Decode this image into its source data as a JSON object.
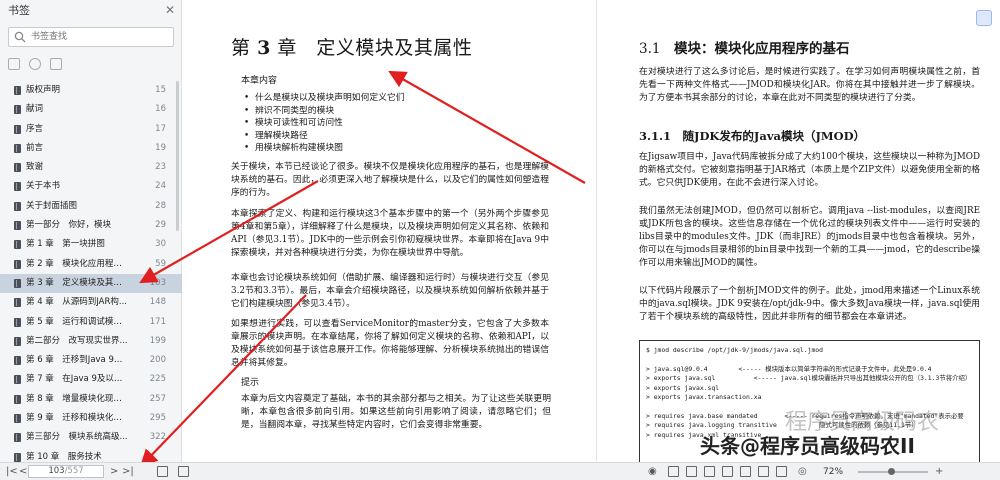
{
  "sidebar": {
    "title": "书签",
    "search_placeholder": "书签查找",
    "items": [
      {
        "label": "版权声明",
        "page": "15"
      },
      {
        "label": "献词",
        "page": "16"
      },
      {
        "label": "序言",
        "page": "17"
      },
      {
        "label": "前言",
        "page": "19"
      },
      {
        "label": "致谢",
        "page": "23"
      },
      {
        "label": "关于本书",
        "page": "24"
      },
      {
        "label": "关于封面插图",
        "page": "28"
      },
      {
        "label": "第一部分　你好，模块",
        "page": "29"
      },
      {
        "label": "第 1 章　第一块拼图",
        "page": "30"
      },
      {
        "label": "第 2 章　模块化应用程序...",
        "page": "59"
      },
      {
        "label": "第 3 章　定义模块及其属性",
        "page": "103"
      },
      {
        "label": "第 4 章　从源码到JAR构...",
        "page": "148"
      },
      {
        "label": "第 5 章　运行和调试模块...",
        "page": "171"
      },
      {
        "label": "第二部分　改写现实世界...",
        "page": "199"
      },
      {
        "label": "第 6 章　迁移到Java 9及...",
        "page": "200"
      },
      {
        "label": "第 7 章　在Java 9及以上...",
        "page": "225"
      },
      {
        "label": "第 8 章　增量模块化现有...",
        "page": "257"
      },
      {
        "label": "第 9 章　迁移和模块化策略",
        "page": "295"
      },
      {
        "label": "第三部分　模块系统高级...",
        "page": "322"
      },
      {
        "label": "第 10 章　服务技术",
        "page": ""
      }
    ],
    "active_index": 10
  },
  "bottombar": {
    "current_page": "103",
    "total_pages": "/557",
    "zoom": "72%"
  },
  "left_page": {
    "chapter_prefix": "第",
    "chapter_num": "3",
    "chapter_suffix": "章　定义模块及其属性",
    "contents_label": "本章内容",
    "bullets": [
      "什么是模块以及模块声明如何定义它们",
      "辨识不同类型的模块",
      "模块可读性和可访问性",
      "理解模块路径",
      "用模块解析构建模块图"
    ],
    "p1": "关于模块，本节已经谈论了很多。模块不仅是模块化应用程序的基石，也是理解模块系统的基石。因此，必须更深入地了解模块是什么，以及它们的属性如何塑造程序的行为。",
    "p2": "本章探索了定义、构建和运行模块这3个基本步骤中的第一个（另外两个步骤参见第4章和第5章），详细解释了什么是模块，以及模块声明如何定义其名称、依赖和API（参见3.1节）。JDK中的一些示例会引你初窥模块世界。本章即将在Java 9中探索模块，并对各种模块进行分类，为你在模块世界中导航。",
    "p3": "本章也会讨论模块系统如何（借助扩展、编译器和运行时）与模块进行交互（参见3.2节和3.3节）。最后，本章会介绍模块路径，以及模块系统如何解析依赖并基于它们构建模块图（参见3.4节）。",
    "p4": "如果想进行实践，可以查看ServiceMonitor的master分支，它包含了大多数本章展示的模块声明。在本章结尾，你将了解如何定义模块的名称、依赖和API，以及模块系统如何基于该信息展开工作。你将能够理解、分析模块系统抛出的错误信息并将其修复。",
    "hint_label": "提示",
    "p5": "本章为后文内容奠定了基础，本书的其余部分都与之相关。为了让这些关联更明晰，本章包含很多前向引用。如果这些前向引用影响了阅读，请忽略它们；但是，当翻阅本章，寻找某些特定内容时，它们会变得非常重要。"
  },
  "right_page": {
    "sec_num": "3.1",
    "sec_title": "模块：模块化应用程序的基石",
    "p1": "在对模块进行了这么多讨论后，是时候进行实践了。在学习如何声明模块属性之前，首先看一下两种文件格式——JMOD和模块化JAR。你将在其中接触并进一步了解模块。为了方便本书其余部分的讨论，本章在此对不同类型的模块进行了分类。",
    "sub_num": "3.1.1",
    "sub_title": "随JDK发布的Java模块（JMOD）",
    "p2": "在Jigsaw项目中，Java代码库被拆分成了大约100个模块，这些模块以一种称为JMOD的新格式交付。它被刻意指明基于JAR格式（本质上是个ZIP文件）以避免使用全新的格式。它只供JDK使用，在此不会进行深入讨论。",
    "p3": "我们虽然无法创建JMOD，但仍然可以剖析它。调用java --list-modules，以查阅JRE或JDK所包含的模块。这些信息存储在一个优化过的模块列表文件中——运行时安装的libs目录中的modules文件。JDK（而非JRE）的jmods目录中也包含着模块。另外，你可以在与jmods目录相邻的bin目录中找到一个新的工具——jmod，它的describe操作可以用来输出JMOD的属性。",
    "p4": "以下代码片段展示了一个剖析JMOD文件的例子。此处，jmod用来描述一个Linux系统中的java.sql模块。JDK 9安装在/opt/jdk-9中。像大多数Java模块一样，java.sql使用了若干个模块系统的高级特性，因此并非所有的细节都会在本章讲述。",
    "code": "$ jmod describe /opt/jdk-9/jmods/java.sql.jmod\n\n> java.sql@9.0.4        <----- 模块版本以简单字符串的形式记录于文件中。此处是9.0.4\n> exports java.sql          <----- java.sql模块囊括并只导出其他模块公开的包（3.1.3节将介绍）\n> exports javax.sql\n> exports javax.transaction.xa\n\n> requires java.base mandated       <----- requires指令声明依赖。末语\"mandated\"表示必要\n> requires java.logging transitive           隐式可读性的依赖（参见11.1节）\n> requires java.xml transitive"
  },
  "watermark": "头条@程序员高级码农II",
  "watermark_ghost": "程序员高级码农"
}
